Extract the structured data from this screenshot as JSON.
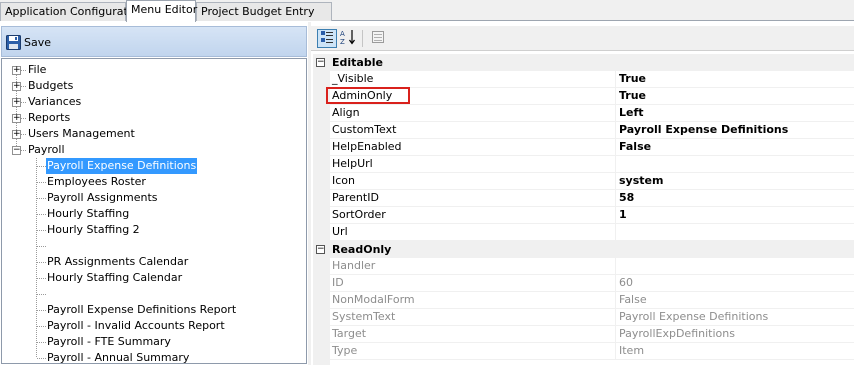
{
  "tabs": [
    "Application Configuration",
    "Menu Editor",
    "Project Budget Entry"
  ],
  "active_tab": 1,
  "left_toolbar": {
    "save_label": "Save"
  },
  "tree": {
    "roots": [
      "File",
      "Budgets",
      "Variances",
      "Reports",
      "Users Management"
    ],
    "payroll_label": "Payroll",
    "children": [
      "Payroll Expense Definitions",
      "Employees Roster",
      "Payroll Assignments",
      "Hourly Staffing",
      "Hourly Staffing 2",
      "",
      "PR Assignments Calendar",
      "Hourly Staffing Calendar",
      "",
      "Payroll Expense Definitions Report",
      "Payroll - Invalid Accounts Report",
      "Payroll - FTE Summary",
      "Payroll - Annual Summary"
    ],
    "selected_child": 0
  },
  "grid": {
    "categories": {
      "editable": "Editable",
      "readonly": "ReadOnly"
    },
    "editable_props": [
      {
        "name": "_Visible",
        "value": "True"
      },
      {
        "name": "AdminOnly",
        "value": "True"
      },
      {
        "name": "Align",
        "value": "Left"
      },
      {
        "name": "CustomText",
        "value": "Payroll Expense Definitions"
      },
      {
        "name": "HelpEnabled",
        "value": "False"
      },
      {
        "name": "HelpUrl",
        "value": ""
      },
      {
        "name": "Icon",
        "value": "system"
      },
      {
        "name": "ParentID",
        "value": "58"
      },
      {
        "name": "SortOrder",
        "value": "1"
      },
      {
        "name": "Url",
        "value": ""
      }
    ],
    "readonly_props": [
      {
        "name": "Handler",
        "value": ""
      },
      {
        "name": "ID",
        "value": "60"
      },
      {
        "name": "NonModalForm",
        "value": "False"
      },
      {
        "name": "SystemText",
        "value": "Payroll Expense Definitions"
      },
      {
        "name": "Target",
        "value": "PayrollExpDefinitions"
      },
      {
        "name": "Type",
        "value": "Item"
      }
    ]
  },
  "colors": {
    "selection": "#3399ff",
    "highlight_box": "#d9211c"
  },
  "icons": {
    "save": "floppy-disk-icon",
    "categorized": "categorized-view-icon",
    "alphabetical": "sort-az-icon",
    "property_pages": "property-pages-icon"
  }
}
